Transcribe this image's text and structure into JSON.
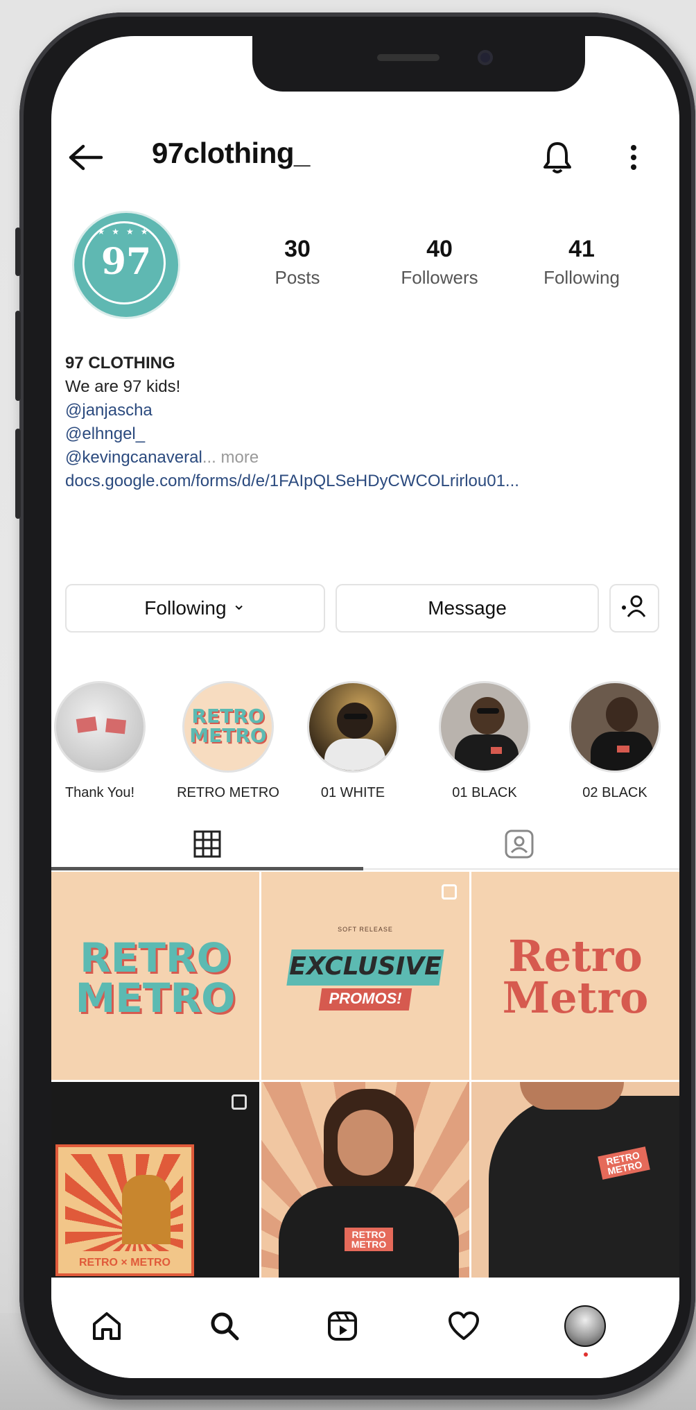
{
  "header": {
    "username": "97clothing_"
  },
  "profile": {
    "avatar_text": "97",
    "avatar_stars": "★★★★",
    "stats": [
      {
        "value": "30",
        "label": "Posts"
      },
      {
        "value": "40",
        "label": "Followers"
      },
      {
        "value": "41",
        "label": "Following"
      }
    ],
    "bio": {
      "name": "97 CLOTHING",
      "line1": "We are 97 kids!",
      "mention1": "@janjascha",
      "mention2": "@elhngel_",
      "mention3": "@kevingcanaveral",
      "more": "... more",
      "url": "docs.google.com/forms/d/e/1FAIpQLSeHDyCWCOLrirlou01..."
    }
  },
  "actions": {
    "following": "Following",
    "following_chevron": "⌄",
    "message": "Message"
  },
  "highlights": [
    {
      "label": "Thank You!"
    },
    {
      "label": "RETRO METRO",
      "badge_line1": "RETRO",
      "badge_line2": "METRO"
    },
    {
      "label": "01 WHITE"
    },
    {
      "label": "01 BLACK"
    },
    {
      "label": "02 BLACK"
    }
  ],
  "posts": {
    "tile1": {
      "line1": "RETRO",
      "line2": "METRO"
    },
    "tile2": {
      "kicker": "SOFT RELEASE",
      "headline": "EXCLUSIVE",
      "sub": "PROMOS!"
    },
    "tile3": {
      "line1": "Retro",
      "line2": "Metro"
    },
    "tile4": {
      "caption": "RETRO × METRO"
    },
    "tile5": {
      "shirt_print": "RETRO METRO"
    },
    "tile6": {
      "shirt_print": "RETRO METRO"
    }
  },
  "colors": {
    "teal": "#5fb8b2",
    "peach": "#f5d3b0",
    "coral": "#d65a4f",
    "link": "#2b4a7e"
  }
}
